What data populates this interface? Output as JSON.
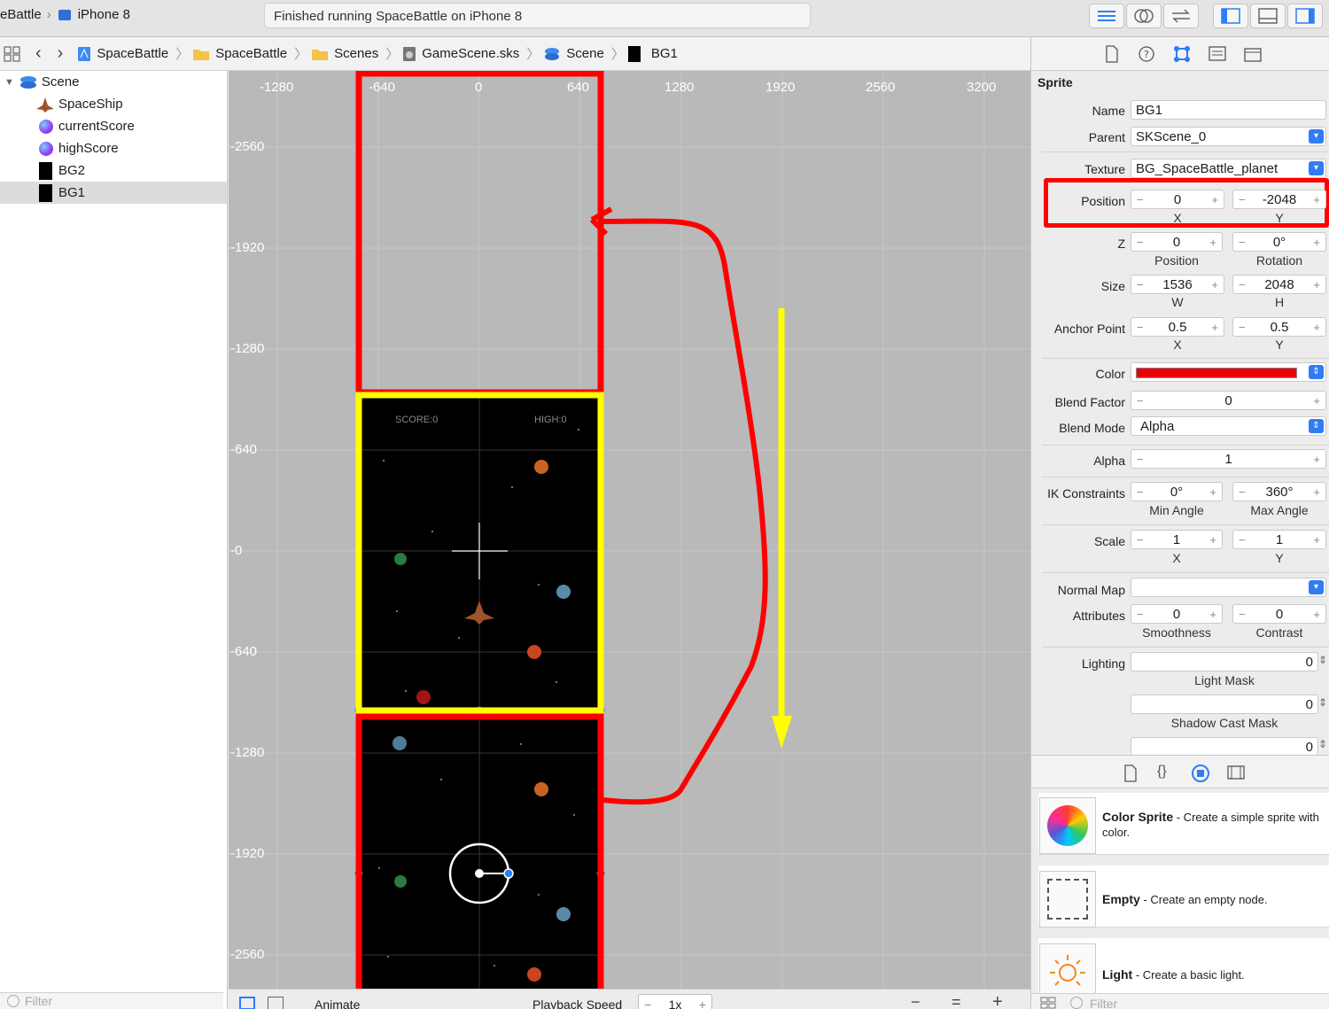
{
  "toolbar": {
    "scheme": "eBattle",
    "device": "iPhone 8",
    "status": "Finished running SpaceBattle on iPhone 8"
  },
  "breadcrumb": [
    "SpaceBattle",
    "SpaceBattle",
    "Scenes",
    "GameScene.sks",
    "Scene",
    "BG1"
  ],
  "navigator": {
    "root": "Scene",
    "items": [
      "SpaceShip",
      "currentScore",
      "highScore",
      "BG2",
      "BG1"
    ],
    "selected": "BG1",
    "filter_placeholder": "Filter"
  },
  "canvas": {
    "ruler_x": [
      "-1280",
      "-640",
      "0",
      "640",
      "1280",
      "1920",
      "2560",
      "3200"
    ],
    "ruler_y": [
      "-2560",
      "-1920",
      "-1280",
      "-640",
      "-0",
      "-640",
      "-1280",
      "-1920",
      "-2560"
    ],
    "score_label": "SCORE:0",
    "high_label": "HIGH:0",
    "colors": {
      "highlight_red": "#ff0000",
      "highlight_yellow": "#ffff00",
      "background": "#b9b9b9"
    }
  },
  "bottombar": {
    "animate": "Animate",
    "playback_label": "Playback Speed",
    "speed": "1x"
  },
  "inspector": {
    "section": "Sprite",
    "name_label": "Name",
    "name": "BG1",
    "parent_label": "Parent",
    "parent": "SKScene_0",
    "texture_label": "Texture",
    "texture": "BG_SpaceBattle_planet",
    "position_label": "Position",
    "position_x": "0",
    "position_y": "-2048",
    "x": "X",
    "y": "Y",
    "z_label": "Z",
    "z_position": "0",
    "z_rotation": "0°",
    "position_sub": "Position",
    "rotation_sub": "Rotation",
    "size_label": "Size",
    "size_w": "1536",
    "size_h": "2048",
    "w": "W",
    "h": "H",
    "anchor_label": "Anchor Point",
    "anchor_x": "0.5",
    "anchor_y": "0.5",
    "color_label": "Color",
    "color_value": "#e8000b",
    "blend_factor_label": "Blend Factor",
    "blend_factor": "0",
    "blend_mode_label": "Blend Mode",
    "blend_mode": "Alpha",
    "alpha_label": "Alpha",
    "alpha": "1",
    "ik_label": "IK Constraints",
    "ik_min": "0°",
    "ik_max": "360°",
    "min_angle": "Min Angle",
    "max_angle": "Max Angle",
    "scale_label": "Scale",
    "scale_x": "1",
    "scale_y": "1",
    "normal_map_label": "Normal Map",
    "attributes_label": "Attributes",
    "smoothness": "0",
    "contrast": "0",
    "smoothness_sub": "Smoothness",
    "contrast_sub": "Contrast",
    "lighting_label": "Lighting",
    "light_mask": "0",
    "light_mask_sub": "Light Mask",
    "shadow_cast": "0",
    "shadow_cast_sub": "Shadow Cast Mask",
    "shadowed": "0"
  },
  "library": [
    {
      "title": "Color Sprite",
      "desc": " - Create a simple sprite with color."
    },
    {
      "title": "Empty",
      "desc": " - Create an empty node."
    },
    {
      "title": "Light",
      "desc": " - Create a basic light."
    }
  ],
  "library_filter": "Filter"
}
